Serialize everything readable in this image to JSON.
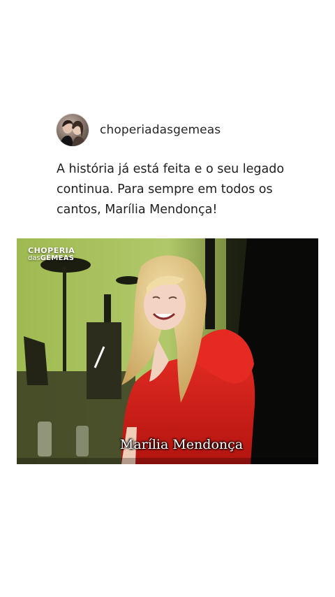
{
  "post": {
    "username": "choperiadasgemeas",
    "caption": "A história já está feita e o seu legado continua. Para sempre em todos os cantos, Marília Mendonça!"
  },
  "video": {
    "brand_top": "CHOPERIA",
    "brand_prefix": "das",
    "brand_suffix": "GÊMEAS",
    "subtitle": "Marília Mendonça"
  },
  "colors": {
    "stage_green": "#a8c25a",
    "dress_red": "#d8201c"
  }
}
